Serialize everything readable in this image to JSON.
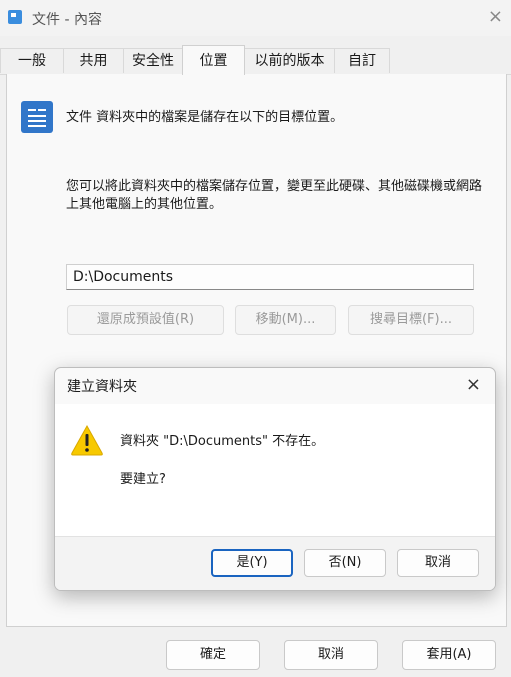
{
  "window": {
    "title": "文件 - 內容",
    "close_glyph": "×"
  },
  "tabs": [
    {
      "label": "一般"
    },
    {
      "label": "共用"
    },
    {
      "label": "安全性"
    },
    {
      "label": "位置"
    },
    {
      "label": "以前的版本"
    },
    {
      "label": "自訂"
    }
  ],
  "active_tab": "位置",
  "location": {
    "icon": "document-folder-icon",
    "description": "文件 資料夾中的檔案是儲存在以下的目標位置。",
    "instructions": "您可以將此資料夾中的檔案儲存位置，變更至此硬碟、其他磁碟機或網路上其他電腦上的其他位置。",
    "path_value": "D:\\Documents",
    "restore_default_label": "還原成預設值(R)",
    "move_label": "移動(M)...",
    "find_target_label": "搜尋目標(F)..."
  },
  "dialog": {
    "title": "建立資料夾",
    "close_glyph": "×",
    "icon": "warning-icon",
    "message": "資料夾 \"D:\\Documents\" 不存在。",
    "question": "要建立?",
    "yes_label": "是(Y)",
    "no_label": "否(N)",
    "cancel_label": "取消"
  },
  "footer": {
    "ok_label": "確定",
    "cancel_label": "取消",
    "apply_label": "套用(A)"
  },
  "colors": {
    "accent": "#1a64c0",
    "icon_blue": "#3176c9",
    "warning": "#f7c900"
  }
}
